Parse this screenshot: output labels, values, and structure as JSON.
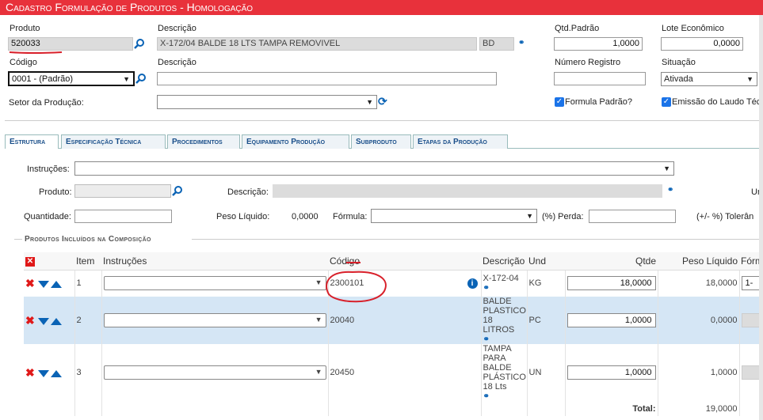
{
  "title": "Cadastro Formulação de Produtos  - Homologação",
  "header": {
    "produto_label": "Produto",
    "produto_value": "520033",
    "descricao_label": "Descrição",
    "descricao_value": "X-172/04 BALDE 18 LTS TAMPA REMOVIVEL",
    "unidade_value": "BD",
    "qtd_padrao_label": "Qtd.Padrão",
    "qtd_padrao_value": "1,0000",
    "lote_label": "Lote Econômico",
    "lote_value": "0,0000",
    "codigo_label": "Código",
    "codigo_value": "0001 - (Padrão)",
    "descricao2_label": "Descrição",
    "descricao2_value": "",
    "numero_registro_label": "Número Registro",
    "numero_registro_value": "",
    "situacao_label": "Situação",
    "situacao_value": "Ativada",
    "setor_label": "Setor da Produção:",
    "setor_value": "",
    "formula_padrao_label": "Formula Padrão?",
    "emissao_laudo_label": "Emissão do Laudo Téc"
  },
  "tabs": [
    {
      "label": "Estrutura",
      "active": true
    },
    {
      "label": "Especificação Técnica",
      "active": false
    },
    {
      "label": "Procedimentos",
      "active": false
    },
    {
      "label": "Equipamento Produção",
      "active": false
    },
    {
      "label": "Subproduto",
      "active": false
    },
    {
      "label": "Etapas da Produção",
      "active": false
    }
  ],
  "form": {
    "instrucoes_label": "Instruções:",
    "instrucoes_value": "",
    "produto_label": "Produto:",
    "descricao_label": "Descrição:",
    "un_label": "Un",
    "quantidade_label": "Quantidade:",
    "peso_liquido_label": "Peso Líquido:",
    "peso_liquido_value": "0,0000",
    "formula_label": "Fórmula:",
    "perda_label": "(%) Perda:",
    "tolerancia_label": "(+/- %) Tolerân"
  },
  "section": {
    "title": "Produtos Incluídos na Composição"
  },
  "grid": {
    "columns": {
      "item": "Item",
      "instrucoes": "Instruções",
      "codigo": "Código",
      "descricao": "Descrição",
      "und": "Und",
      "qtde": "Qtde",
      "peso": "Peso Líquido",
      "formula": "Fórm"
    },
    "rows": [
      {
        "item": "1",
        "codigo": "2300101",
        "descricao": "X-172-04",
        "und": "KG",
        "qtde": "18,0000",
        "peso": "18,0000",
        "formula": "1-"
      },
      {
        "item": "2",
        "codigo": "20040",
        "descricao": "BALDE PLASTICO 18 LITROS",
        "und": "PC",
        "qtde": "1,0000",
        "peso": "0,0000",
        "formula": ""
      },
      {
        "item": "3",
        "codigo": "20450",
        "descricao": "TAMPA PARA BALDE PLÁSTICO 18 Lts",
        "und": "UN",
        "qtde": "1,0000",
        "peso": "1,0000",
        "formula": ""
      }
    ],
    "total_label": "Total:",
    "total_value": "19,0000"
  },
  "colors": {
    "title_bg": "#e8313b",
    "accent_blue": "#0a63b5",
    "selected_row": "#d5e6f5",
    "annotation_red": "#d8202a"
  }
}
